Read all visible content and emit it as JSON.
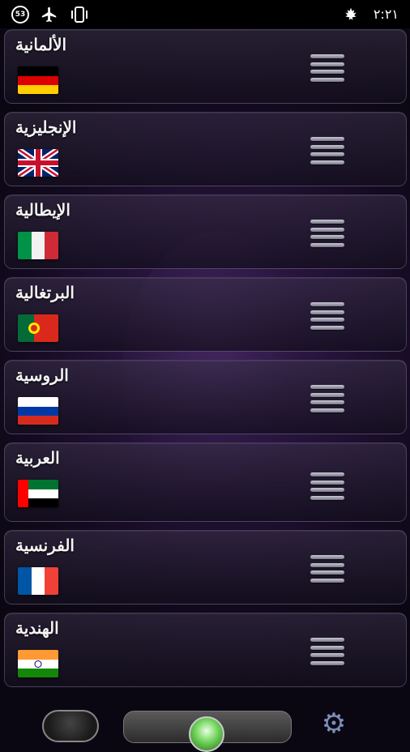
{
  "status_bar": {
    "notification_count": "53",
    "time": "٢:٢١"
  },
  "languages": [
    {
      "name": "الألمانية",
      "flag": "germany-flag"
    },
    {
      "name": "الإنجليزية",
      "flag": "uk-flag"
    },
    {
      "name": "الإيطالية",
      "flag": "italy-flag"
    },
    {
      "name": "البرتغالية",
      "flag": "portugal-flag"
    },
    {
      "name": "الروسية",
      "flag": "russia-flag"
    },
    {
      "name": "العربية",
      "flag": "uae-flag"
    },
    {
      "name": "الفرنسية",
      "flag": "france-flag"
    },
    {
      "name": "الهندية",
      "flag": "india-flag"
    }
  ]
}
